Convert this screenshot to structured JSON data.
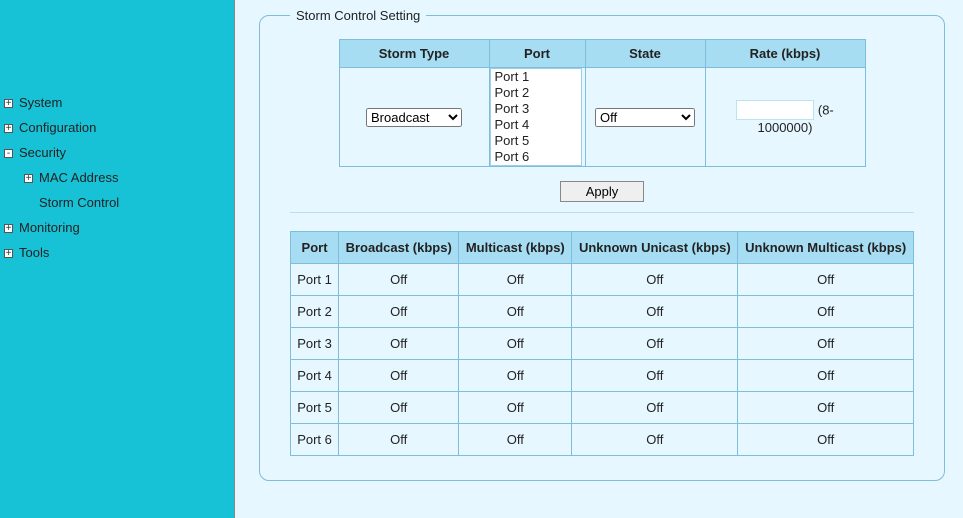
{
  "sidebar": {
    "items": [
      {
        "expand": "+",
        "label": "System",
        "level": 0
      },
      {
        "expand": "+",
        "label": "Configuration",
        "level": 0
      },
      {
        "expand": "-",
        "label": "Security",
        "level": 0
      },
      {
        "expand": "+",
        "label": "MAC Address",
        "level": 1
      },
      {
        "expand": "",
        "label": "Storm Control",
        "level": 1
      },
      {
        "expand": "+",
        "label": "Monitoring",
        "level": 0
      },
      {
        "expand": "+",
        "label": "Tools",
        "level": 0
      }
    ]
  },
  "panel": {
    "legend": "Storm Control Setting",
    "setting": {
      "headers": {
        "storm_type": "Storm Type",
        "port": "Port",
        "state": "State",
        "rate": "Rate (kbps)"
      },
      "storm_type_selected": "Broadcast",
      "ports": [
        "Port 1",
        "Port 2",
        "Port 3",
        "Port 4",
        "Port 5",
        "Port 6"
      ],
      "state_selected": "Off",
      "rate_value": "",
      "rate_hint": "(8-1000000)"
    },
    "apply_label": "Apply",
    "status": {
      "headers": {
        "port": "Port",
        "broadcast": "Broadcast (kbps)",
        "multicast": "Multicast (kbps)",
        "unknown_unicast": "Unknown Unicast (kbps)",
        "unknown_multicast": "Unknown Multicast (kbps)"
      },
      "rows": [
        {
          "port": "Port 1",
          "broadcast": "Off",
          "multicast": "Off",
          "unknown_unicast": "Off",
          "unknown_multicast": "Off"
        },
        {
          "port": "Port 2",
          "broadcast": "Off",
          "multicast": "Off",
          "unknown_unicast": "Off",
          "unknown_multicast": "Off"
        },
        {
          "port": "Port 3",
          "broadcast": "Off",
          "multicast": "Off",
          "unknown_unicast": "Off",
          "unknown_multicast": "Off"
        },
        {
          "port": "Port 4",
          "broadcast": "Off",
          "multicast": "Off",
          "unknown_unicast": "Off",
          "unknown_multicast": "Off"
        },
        {
          "port": "Port 5",
          "broadcast": "Off",
          "multicast": "Off",
          "unknown_unicast": "Off",
          "unknown_multicast": "Off"
        },
        {
          "port": "Port 6",
          "broadcast": "Off",
          "multicast": "Off",
          "unknown_unicast": "Off",
          "unknown_multicast": "Off"
        }
      ]
    }
  }
}
